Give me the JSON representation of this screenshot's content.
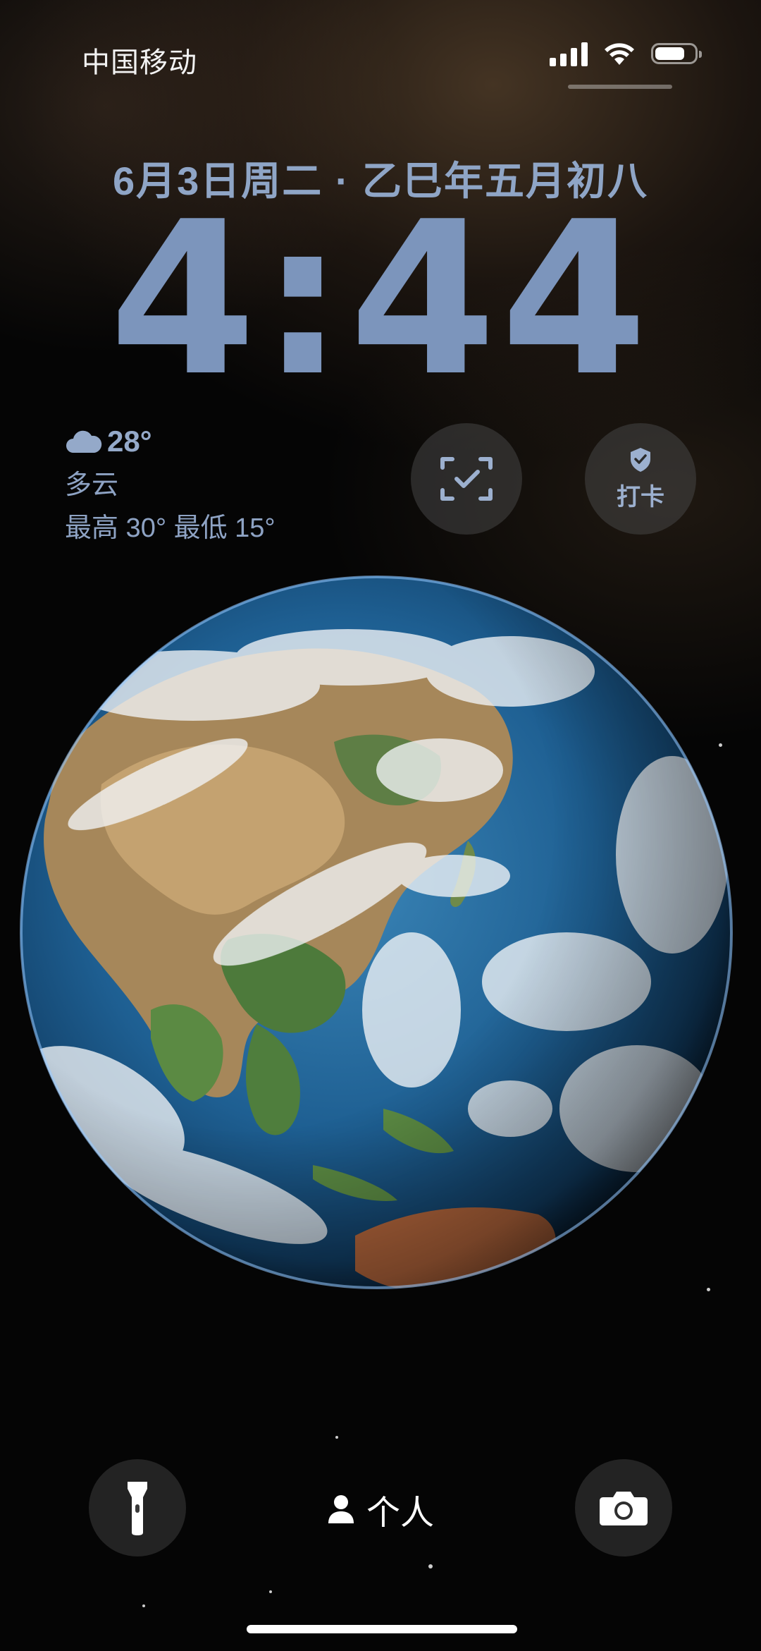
{
  "status_bar": {
    "carrier": "中国移动",
    "battery_level": 0.75,
    "signal_bars": 4
  },
  "lock_screen": {
    "date_line": "6月3日周二 · 乙巳年五月初八",
    "time": "4:44"
  },
  "weather_widget": {
    "icon": "cloud-icon",
    "temperature": "28°",
    "condition": "多云",
    "range": "最高 30° 最低 15°"
  },
  "widgets": {
    "scan_icon": "scan-check-icon",
    "checkin_label": "打卡",
    "checkin_icon": "shield-check-icon"
  },
  "wallpaper": {
    "subject": "earth-globe"
  },
  "bottom": {
    "focus_mode_label": "个人",
    "flashlight_icon": "flashlight-icon",
    "camera_icon": "camera-icon",
    "person_icon": "person-icon"
  },
  "colors": {
    "accent_text": "#8fa5c6",
    "clock": "#7c95bc",
    "widget_bg": "#464646"
  }
}
